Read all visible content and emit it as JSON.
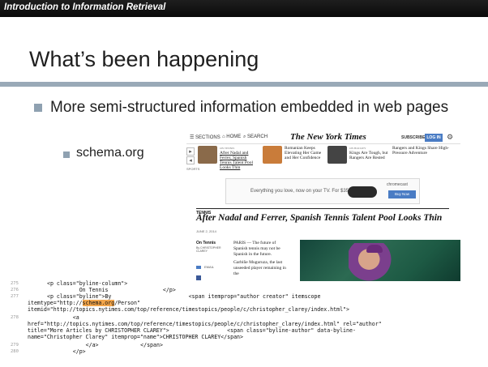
{
  "header": {
    "course_title": "Introduction to Information Retrieval"
  },
  "slide": {
    "title": "What’s been happening",
    "bullet_1": "More semi-structured information embedded in web pages",
    "bullet_2": "schema.org"
  },
  "nyt": {
    "header_left": "☰ SECTIONS",
    "header_home": "⌂ HOME",
    "header_search": "⌕ SEARCH",
    "logo": "The New York Times",
    "subscribe": "SUBSCRIBE",
    "login": "LOG IN",
    "sports_label": "SPORTS",
    "stories": [
      {
        "category": "ON TENNIS",
        "text": "After Nadal and Ferrer, Spanish Tennis Talent Pool Looks Thin",
        "thumb_color": "#8a6a4a"
      },
      {
        "category": "",
        "text": "Romanian Keeps Elevating Her Game and Her Confidence",
        "thumb_color": "#c97c3a"
      },
      {
        "category": "ON HOCKEY",
        "text": "Kings Are Tough, but Rangers Are Rested",
        "thumb_color": "#444444"
      },
      {
        "category": "",
        "text": "Rangers and Kings Share High-Pressure Adventure",
        "thumb_color": "#ffffff"
      }
    ],
    "ad_text": "Everything you love, now on your TV. For $35.",
    "ad_brand": "chromecast",
    "ad_button": "Buy Now",
    "section": "TENNIS",
    "headline": "After Nadal and Ferrer, Spanish Tennis Talent Pool Looks Thin",
    "date": "JUNE 2, 2014",
    "column": "On Tennis",
    "byline": "By CHRISTOPHER CLAREY",
    "email": "EMAIL",
    "body_p1": "PARIS — The future of Spanish tennis may not be Spanish in the future.",
    "body_p2": "Garbiñe Muguruza, the last unseeded player remaining in the"
  },
  "code": {
    "lines": [
      {
        "num": "275",
        "text": "<p class=\"byline-column\">"
      },
      {
        "num": "276",
        "text": "          On Tennis                 </p>"
      },
      {
        "num": "277",
        "pre": "<p class=\"byline\">By                        <span itemprop=\"author creator\" itemscope"
      },
      {
        "num": "",
        "pre": "itemtype=\"http://",
        "hl": "schema.org",
        "post": "/Person\""
      },
      {
        "num": "",
        "text": "itemid=\"http://topics.nytimes.com/top/reference/timestopics/people/c/christopher_clarey/index.html\">"
      },
      {
        "num": "278",
        "text": "        <a"
      },
      {
        "num": "",
        "text": "href=\"http://topics.nytimes.com/top/reference/timestopics/people/c/christopher_clarey/index.html\" rel=\"author\""
      },
      {
        "num": "",
        "text": "title=\"More Articles by CHRISTOPHER CLAREY\">                  <span class=\"byline-author\" data-byline-"
      },
      {
        "num": "",
        "text": "name=\"Christopher Clarey\" itemprop=\"name\">CHRISTOPHER CLAREY</span>"
      },
      {
        "num": "279",
        "text": "            </a>             </span>"
      },
      {
        "num": "280",
        "text": "        </p>"
      }
    ]
  }
}
